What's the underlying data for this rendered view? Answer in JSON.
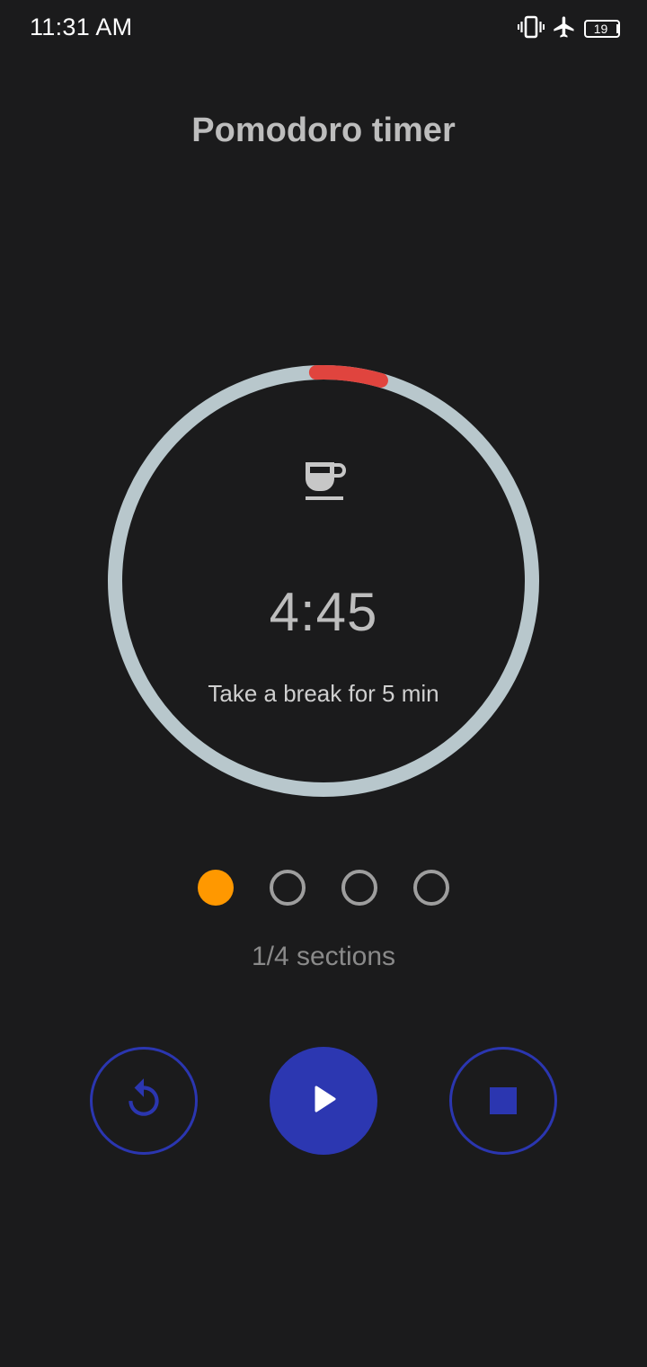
{
  "status_bar": {
    "time": "11:31 AM",
    "icons": [
      "vibrate-icon",
      "airplane-mode-icon",
      "battery-icon"
    ],
    "battery_level": "19"
  },
  "header": {
    "title": "Pomodoro timer"
  },
  "timer": {
    "icon": "coffee-cup-icon",
    "remaining": "4:45",
    "caption": "Take a break for 5 min",
    "progress": 0.05,
    "ring_color": "#b8c7cc",
    "progress_color": "#e0443e"
  },
  "sections": {
    "total": 4,
    "completed": 1,
    "label": "1/4 sections",
    "active_color": "#ff9800",
    "inactive_color": "#9e9e9e"
  },
  "controls": {
    "reset_icon": "reset-icon",
    "play_icon": "play-icon",
    "stop_icon": "stop-icon",
    "accent_color": "#2c37b1"
  }
}
